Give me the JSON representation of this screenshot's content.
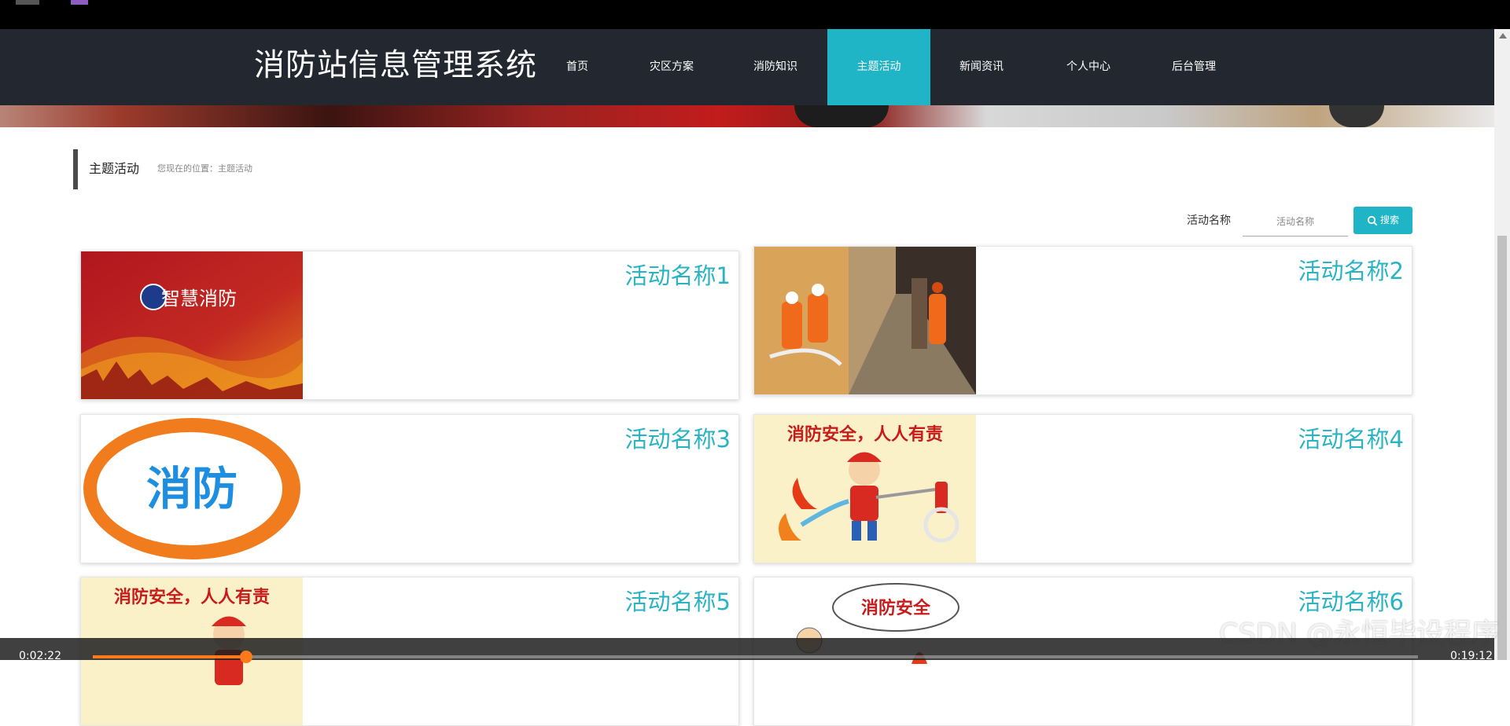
{
  "header": {
    "logo": "消防站信息管理系统",
    "nav": [
      "首页",
      "灾区方案",
      "消防知识",
      "主题活动",
      "新闻资讯",
      "个人中心",
      "后台管理"
    ],
    "active_index": 3
  },
  "breadcrumb": {
    "title": "主题活动",
    "location": "您现在的位置：主题活动"
  },
  "search": {
    "label": "活动名称",
    "placeholder": "活动名称",
    "button": "搜索"
  },
  "cards": [
    {
      "title": "活动名称1",
      "image": "智慧消防"
    },
    {
      "title": "活动名称2",
      "image": "firefighters-photo"
    },
    {
      "title": "活动名称3",
      "image": "消防"
    },
    {
      "title": "活动名称4",
      "image": "消防安全，人人有责"
    },
    {
      "title": "活动名称5",
      "image": "消防安全，人人有责"
    },
    {
      "title": "活动名称6",
      "image": "消防安全"
    }
  ],
  "video": {
    "current": "0:02:22",
    "duration": "0:19:12",
    "progress": 0.116
  },
  "watermark": "CSDN @永恒毕设程序",
  "colors": {
    "accent": "#1fb5c7",
    "nav_bg": "#23272f",
    "card_title": "#2ab3c3",
    "progress": "#ff7a1a"
  }
}
